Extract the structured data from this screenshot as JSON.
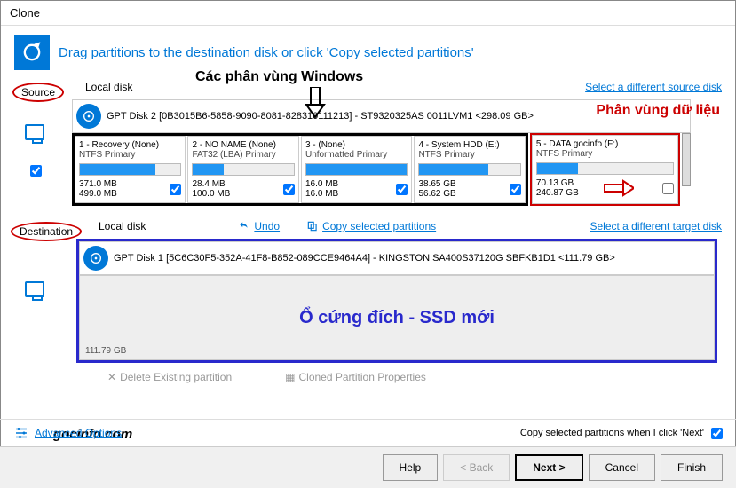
{
  "window": {
    "title": "Clone"
  },
  "header": {
    "instruction": "Drag partitions to the destination disk or click 'Copy selected partitions'"
  },
  "annotations": {
    "windows_partitions": "Các phân vùng Windows",
    "data_partition": "Phân vùng dữ liệu",
    "dest_ssd": "Ổ cứng đích - SSD mới",
    "watermark": "gocinfo.com"
  },
  "source": {
    "label": "Source",
    "local_disk": "Local disk",
    "select_different": "Select a different source disk",
    "disk_name": "GPT Disk 2 [0B3015B6-5858-9090-8081-828310111213] - ST9320325AS 0011LVM1   <298.09 GB>",
    "partitions": [
      {
        "name": "1 - Recovery (None)",
        "type": "NTFS Primary",
        "used": "371.0 MB",
        "total": "499.0 MB",
        "fill": 75,
        "checked": true
      },
      {
        "name": "2 - NO NAME (None)",
        "type": "FAT32 (LBA) Primary",
        "used": "28.4 MB",
        "total": "100.0 MB",
        "fill": 30,
        "checked": true
      },
      {
        "name": "3 - (None)",
        "type": "Unformatted Primary",
        "used": "16.0 MB",
        "total": "16.0 MB",
        "fill": 100,
        "checked": true
      },
      {
        "name": "4 - System HDD (E:)",
        "type": "NTFS Primary",
        "used": "38.65 GB",
        "total": "56.62 GB",
        "fill": 68,
        "checked": true
      },
      {
        "name": "5 - DATA gocinfo (F:)",
        "type": "NTFS Primary",
        "used": "70.13 GB",
        "total": "240.87 GB",
        "fill": 30,
        "checked": false
      }
    ]
  },
  "destination": {
    "label": "Destination",
    "local_disk": "Local disk",
    "undo": "Undo",
    "copy_selected": "Copy selected partitions",
    "select_different": "Select a different target disk",
    "disk_name": "GPT Disk 1 [5C6C30F5-352A-41F8-B852-089CCE9464A4] - KINGSTON SA400S37120G SBFKB1D1   <111.79 GB>",
    "empty_size": "111.79 GB"
  },
  "actions": {
    "delete_partition": "Delete Existing partition",
    "cloned_props": "Cloned Partition Properties",
    "copy_on_next": "Copy selected partitions when I click 'Next'",
    "advanced": "Advanced Options"
  },
  "buttons": {
    "help": "Help",
    "back": "< Back",
    "next": "Next >",
    "cancel": "Cancel",
    "finish": "Finish"
  }
}
